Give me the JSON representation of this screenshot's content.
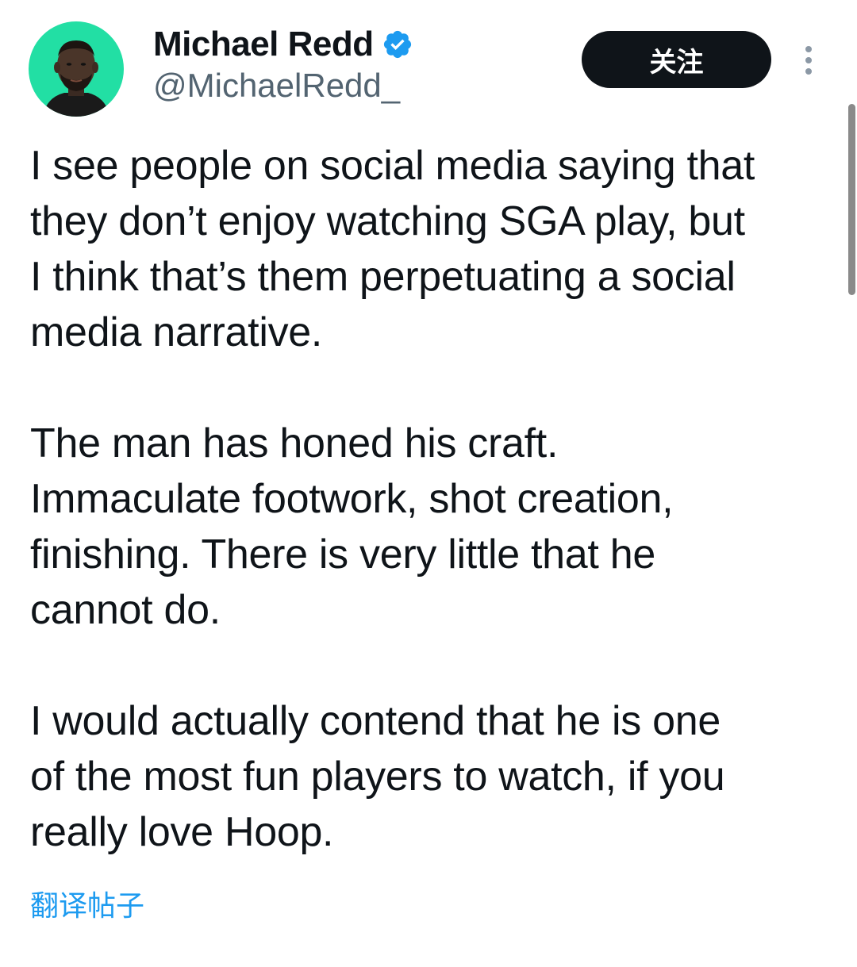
{
  "author": {
    "display_name": "Michael Redd",
    "handle": "@MichaelRedd_",
    "avatar_bg": "#22dfa4",
    "verified_color": "#1d9bf0"
  },
  "header": {
    "follow_label": "关注",
    "more_icon": "more-vertical-icon"
  },
  "tweet": {
    "paragraphs": [
      "I see people on social media saying that\nthey don’t enjoy watching SGA play, but\nI think that’s them perpetuating a social\nmedia narrative.",
      "The man has honed his craft.\nImmaculate footwork, shot creation,\nfinishing. There is very little that he\ncannot do.",
      "I would actually contend that he is one\nof the most fun players to watch, if you\nreally love Hoop."
    ],
    "translate_label": "翻译帖子"
  },
  "colors": {
    "text": "#0f1419",
    "secondary": "#536471",
    "link": "#1d9bf0"
  }
}
